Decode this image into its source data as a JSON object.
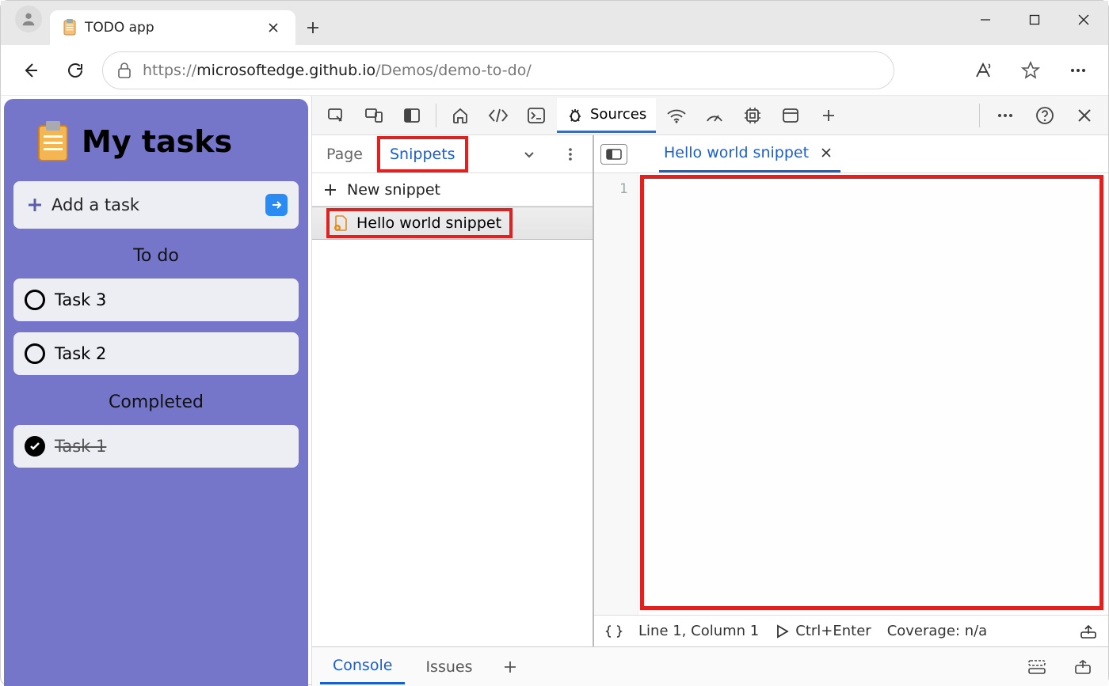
{
  "browser": {
    "tab_title": "TODO app",
    "url_scheme": "https://",
    "url_host": "microsoftedge.github.io",
    "url_path": "/Demos/demo-to-do/"
  },
  "app": {
    "title": "My tasks",
    "add_label": "Add a task",
    "sections": {
      "todo_label": "To do",
      "completed_label": "Completed"
    },
    "todo": [
      "Task 3",
      "Task 2"
    ],
    "completed": [
      "Task 1"
    ]
  },
  "devtools": {
    "tabs": {
      "sources": "Sources"
    },
    "sources": {
      "nav_tabs": {
        "page": "Page",
        "snippets": "Snippets"
      },
      "new_snippet": "New snippet",
      "snippet_name": "Hello world snippet",
      "editor_tab": "Hello world snippet",
      "gutter_line": "1",
      "status": {
        "cursor": "Line 1, Column 1",
        "run": "Ctrl+Enter",
        "coverage": "Coverage: n/a"
      }
    },
    "drawer": {
      "console": "Console",
      "issues": "Issues"
    }
  }
}
